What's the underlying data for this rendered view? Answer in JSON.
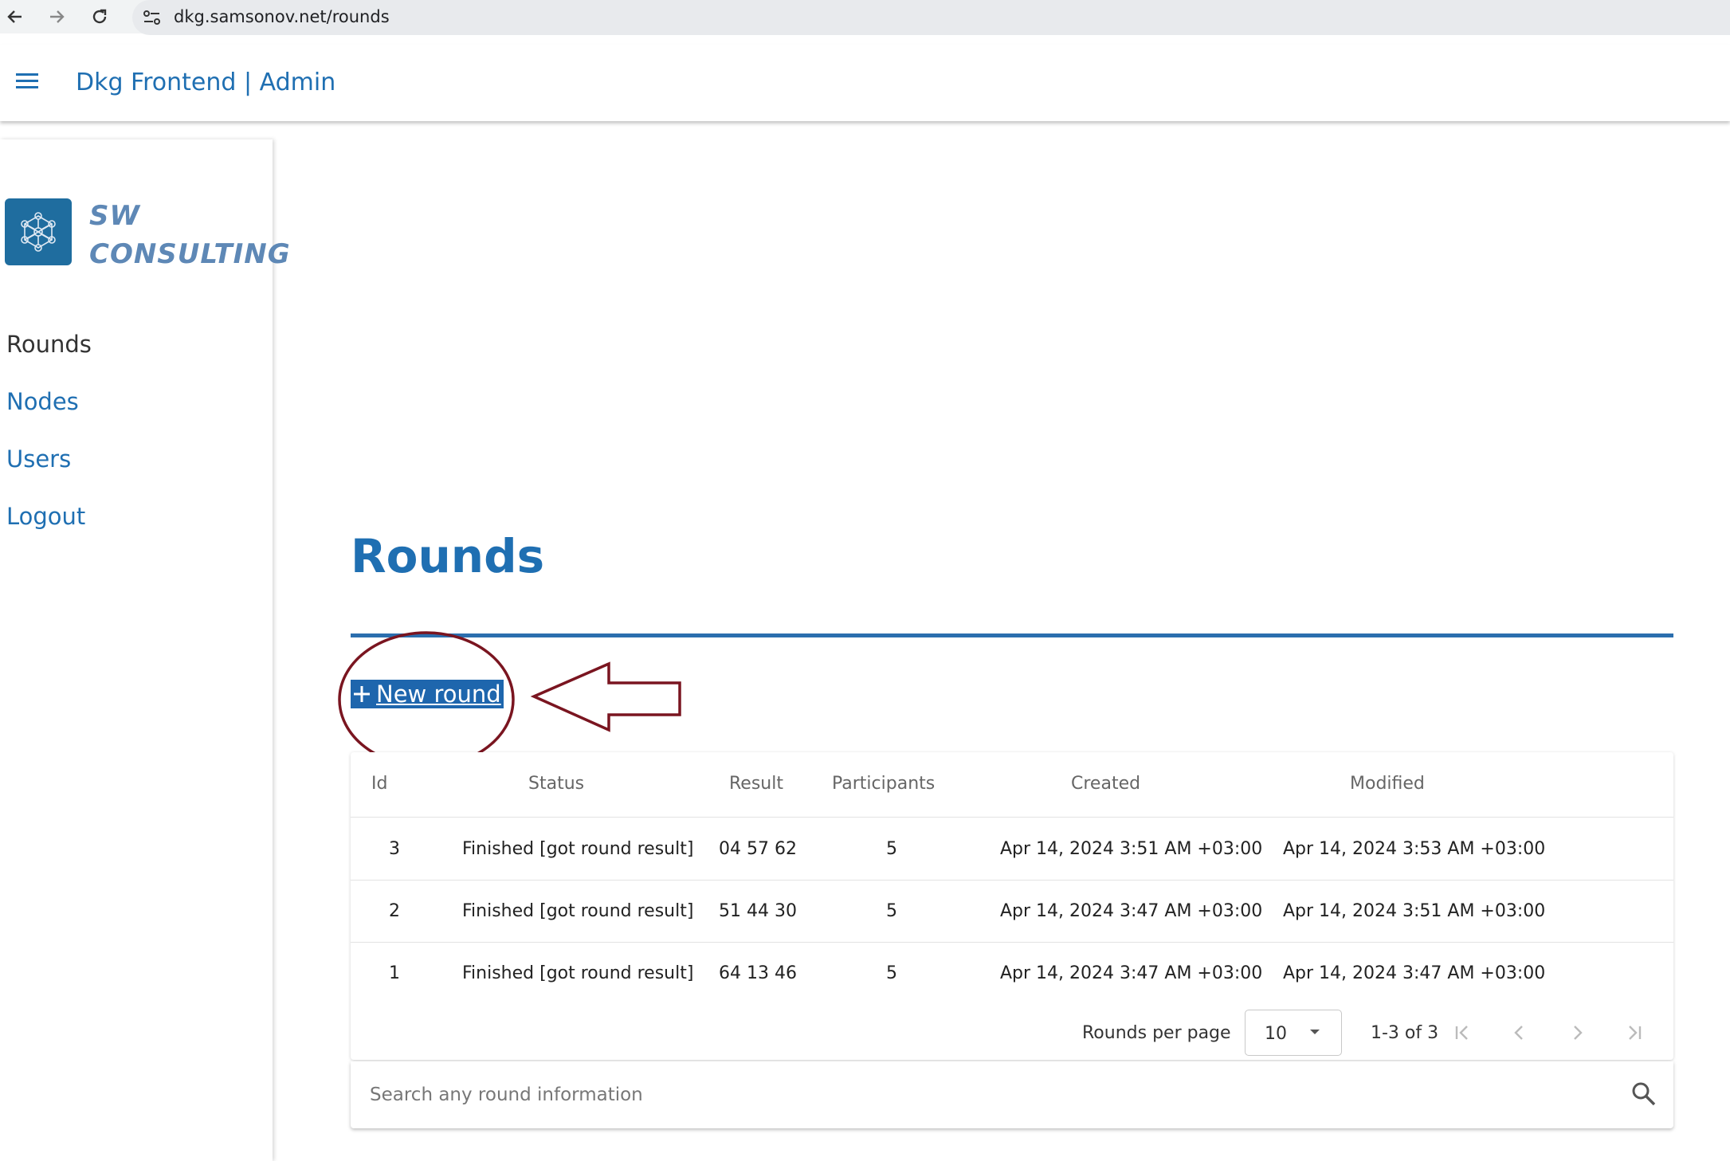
{
  "browser": {
    "url": "dkg.samsonov.net/rounds",
    "icons": [
      "back-arrow-icon",
      "forward-arrow-icon",
      "reload-icon",
      "site-info-icon"
    ]
  },
  "app_bar": {
    "title": "Dkg Frontend | Admin",
    "menu_icon": "hamburger-menu-icon"
  },
  "sidebar": {
    "logo_line1": "SW",
    "logo_line2": "CONSULTING",
    "items": [
      {
        "label": "Rounds",
        "active": true
      },
      {
        "label": "Nodes",
        "active": false
      },
      {
        "label": "Users",
        "active": false
      },
      {
        "label": "Logout",
        "active": false
      }
    ]
  },
  "main": {
    "title": "Rounds",
    "new_round_label": "New round",
    "table": {
      "headers": [
        "Id",
        "Status",
        "Result",
        "Participants",
        "Created",
        "Modified"
      ],
      "rows": [
        {
          "id": "3",
          "status": "Finished [got round result]",
          "result": "04 57 62",
          "participants": "5",
          "created": "Apr 14, 2024 3:51 AM +03:00",
          "modified": "Apr 14, 2024 3:53 AM +03:00"
        },
        {
          "id": "2",
          "status": "Finished [got round result]",
          "result": "51 44 30",
          "participants": "5",
          "created": "Apr 14, 2024 3:47 AM +03:00",
          "modified": "Apr 14, 2024 3:51 AM +03:00"
        },
        {
          "id": "1",
          "status": "Finished [got round result]",
          "result": "64 13 46",
          "participants": "5",
          "created": "Apr 14, 2024 3:47 AM +03:00",
          "modified": "Apr 14, 2024 3:47 AM +03:00"
        }
      ]
    },
    "pagination": {
      "rows_per_page_label": "Rounds per page",
      "rows_per_page_value": "10",
      "range_text": "1-3 of 3"
    },
    "search": {
      "placeholder": "Search any round information"
    }
  },
  "colors": {
    "accent": "#1f6fb2",
    "annotation": "#7a1520"
  }
}
